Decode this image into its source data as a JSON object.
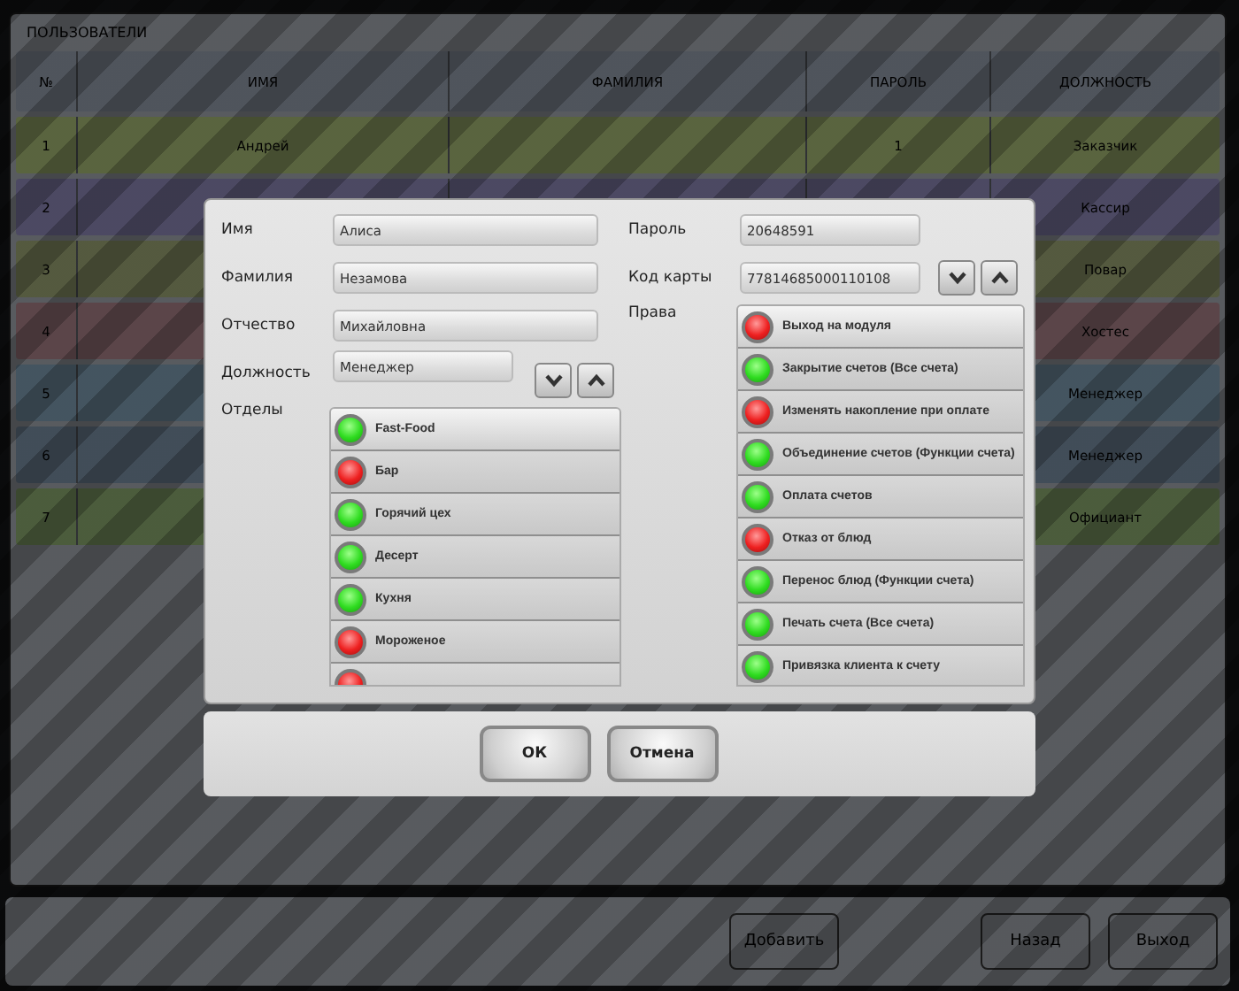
{
  "users": {
    "title": "ПОЛЬЗОВАТЕЛИ",
    "columns": [
      "№",
      "ИМЯ",
      "ФАМИЛИЯ",
      "ПАРОЛЬ",
      "ДОЛЖНОСТЬ"
    ],
    "rows": [
      {
        "number": "1",
        "name": "Андрей",
        "password": "1",
        "position": "Заказчик"
      },
      {
        "number": "2",
        "position": "Кассир"
      },
      {
        "number": "3",
        "position": "Повар"
      },
      {
        "number": "4",
        "position": "Хостес"
      },
      {
        "number": "5",
        "position": "Менеджер"
      },
      {
        "number": "6",
        "position": "Менеджер"
      },
      {
        "number": "7",
        "position": "Официант"
      }
    ]
  },
  "bottom_bar": {
    "buttons": [
      "Добавить",
      "Назад",
      "Выход"
    ]
  },
  "dialog": {
    "fields_left": [
      {
        "label": "Имя",
        "value": "Алиса"
      },
      {
        "label": "Фамилия",
        "value": "Незамова"
      },
      {
        "label": "Отчество",
        "value": "Михайловна"
      }
    ],
    "position": {
      "label": "Должность",
      "value": "Менеджер"
    },
    "departments": {
      "label": "Отделы",
      "items": [
        {
          "label": "Fast-Food",
          "on": true
        },
        {
          "label": "Бар",
          "on": false
        },
        {
          "label": "Горячий цех",
          "on": true
        },
        {
          "label": "Десерт",
          "on": true
        },
        {
          "label": "Кухня",
          "on": true
        },
        {
          "label": "Мороженое",
          "on": false
        },
        {
          "on": false
        }
      ]
    },
    "password": {
      "label": "Пароль",
      "value": "20648591"
    },
    "card": {
      "label": "Код карты",
      "value": "77814685000110108"
    },
    "rights": {
      "label": "Права",
      "items": [
        {
          "label": "Выход на модуля",
          "on": false
        },
        {
          "label": "Закрытие счетов (Все счета)",
          "on": true
        },
        {
          "label": "Изменять накопление при оплате",
          "on": false
        },
        {
          "label": "Объединение счетов (Функции счета)",
          "on": true
        },
        {
          "label": "Оплата счетов",
          "on": true
        },
        {
          "label": "Отказ от блюд",
          "on": false
        },
        {
          "label": "Перенос блюд (Функции счета)",
          "on": true
        },
        {
          "label": "Печать счета (Все счета)",
          "on": true
        },
        {
          "label": "Привязка клиента к счету",
          "on": true
        }
      ]
    },
    "buttons": [
      "ОК",
      "Отмена"
    ]
  }
}
